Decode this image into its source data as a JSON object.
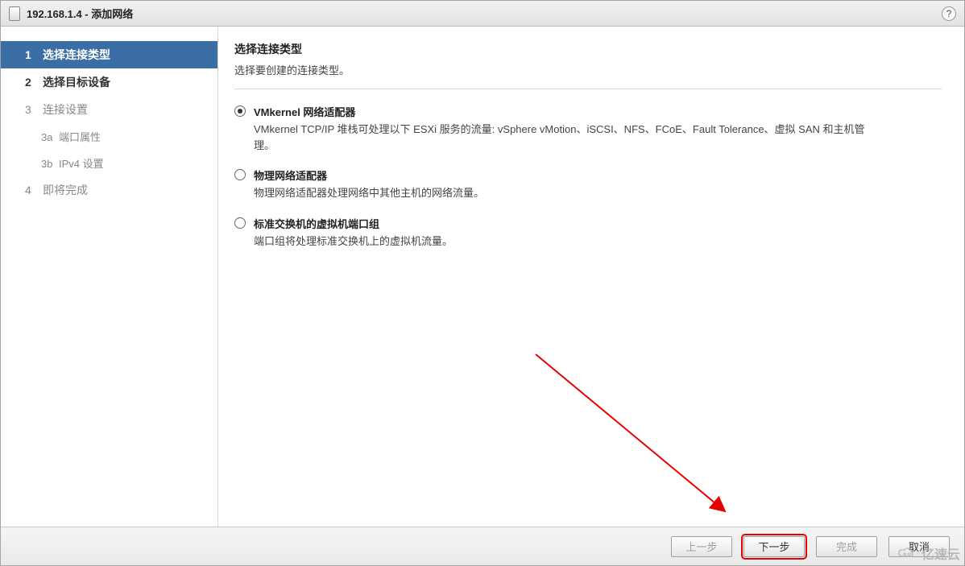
{
  "title": "192.168.1.4 - 添加网络",
  "help_glyph": "?",
  "sidebar": {
    "steps": [
      {
        "num": "1",
        "label": "选择连接类型",
        "active": true
      },
      {
        "num": "2",
        "label": "选择目标设备",
        "bold": true
      },
      {
        "num": "3",
        "label": "连接设置"
      },
      {
        "num": "3a",
        "label": "端口属性",
        "sub": true
      },
      {
        "num": "3b",
        "label": "IPv4 设置",
        "sub": true
      },
      {
        "num": "4",
        "label": "即将完成"
      }
    ]
  },
  "main": {
    "heading": "选择连接类型",
    "subtext": "选择要创建的连接类型。",
    "options": [
      {
        "id": "vmkernel",
        "title": "VMkernel 网络适配器",
        "desc": "VMkernel TCP/IP 堆栈可处理以下 ESXi 服务的流量: vSphere vMotion、iSCSI、NFS、FCoE、Fault Tolerance、虚拟 SAN 和主机管理。",
        "selected": true
      },
      {
        "id": "physical",
        "title": "物理网络适配器",
        "desc": "物理网络适配器处理网络中其他主机的网络流量。",
        "selected": false
      },
      {
        "id": "portgroup",
        "title": "标准交换机的虚拟机端口组",
        "desc": "端口组将处理标准交换机上的虚拟机流量。",
        "selected": false
      }
    ]
  },
  "footer": {
    "back": "上一步",
    "next": "下一步",
    "finish": "完成",
    "cancel": "取消"
  },
  "watermark": "亿速云"
}
